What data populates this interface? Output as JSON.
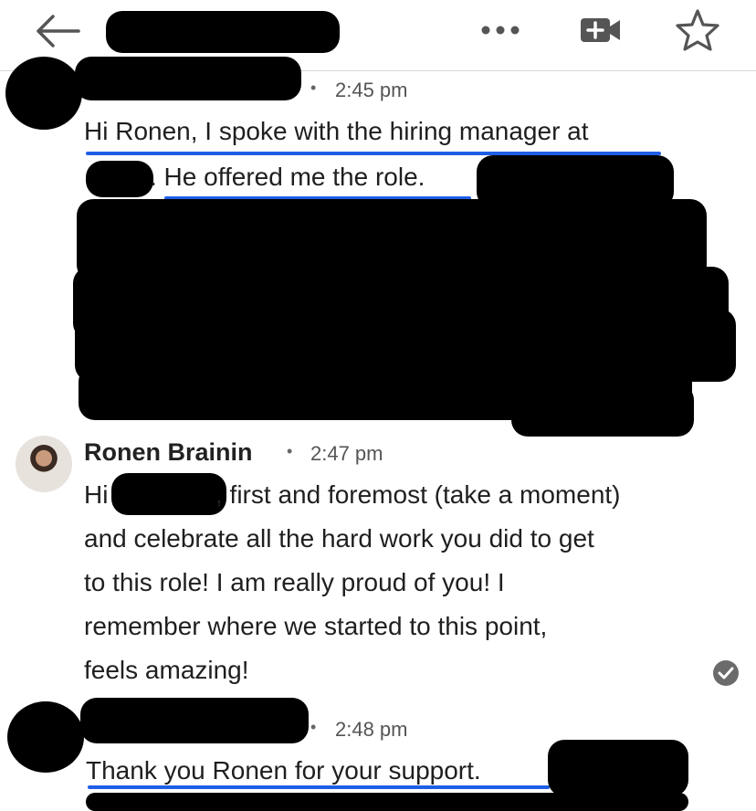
{
  "header": {
    "back_icon": "back-arrow-icon",
    "more_icon": "more-options-icon",
    "video_icon": "add-video-icon",
    "star_icon": "star-icon"
  },
  "messages": [
    {
      "time": "2:45 pm",
      "line1": "Hi Ronen, I spoke with the hiring manager at",
      "line2_visible": ". He offered me the role."
    },
    {
      "sender": "Ronen Brainin",
      "time": "2:47 pm",
      "lines": [
        "Hi",
        ", first and foremost (take a moment)",
        "and celebrate all the hard work you did to get",
        "to this role! I am really proud of you! I",
        "remember where we started to this point,",
        "feels amazing!"
      ]
    },
    {
      "time": "2:48 pm",
      "line1": "Thank you Ronen for your support."
    }
  ],
  "colors": {
    "underline": "#1f5ee6",
    "read_check": "#6b6b6b"
  }
}
